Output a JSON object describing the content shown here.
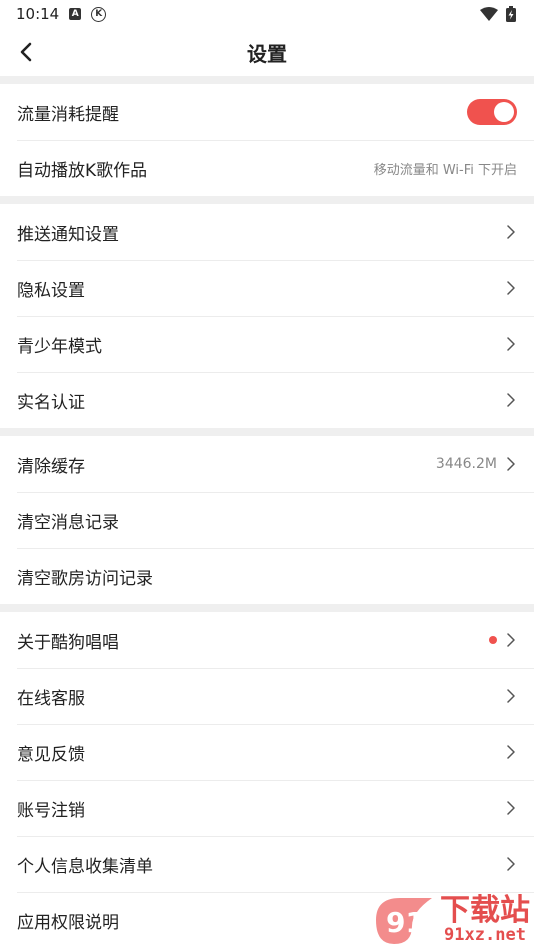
{
  "status_bar": {
    "time": "10:14",
    "icons": [
      "a-badge-icon",
      "k-circle-icon",
      "wifi-icon",
      "battery-charging-icon"
    ]
  },
  "header": {
    "title": "设置",
    "back_icon": "chevron-left-icon"
  },
  "sections": [
    {
      "items": [
        {
          "label": "流量消耗提醒",
          "control": "toggle",
          "toggle_on": true,
          "accent": "#f0524e"
        },
        {
          "label": "自动播放K歌作品",
          "value": "移动流量和 Wi-Fi 下开启"
        }
      ]
    },
    {
      "items": [
        {
          "label": "推送通知设置"
        },
        {
          "label": "隐私设置"
        },
        {
          "label": "青少年模式"
        },
        {
          "label": "实名认证"
        }
      ]
    },
    {
      "items": [
        {
          "label": "清除缓存",
          "value": "3446.2M"
        },
        {
          "label": "清空消息记录"
        },
        {
          "label": "清空歌房访问记录"
        }
      ]
    },
    {
      "items": [
        {
          "label": "关于酷狗唱唱",
          "badge": "red-dot"
        },
        {
          "label": "在线客服"
        },
        {
          "label": "意见反馈"
        },
        {
          "label": "账号注销"
        },
        {
          "label": "个人信息收集清单"
        },
        {
          "label": "应用权限说明"
        }
      ]
    }
  ],
  "watermark": {
    "logo_text": "91",
    "text": "下载站",
    "url": "91xz.net"
  }
}
